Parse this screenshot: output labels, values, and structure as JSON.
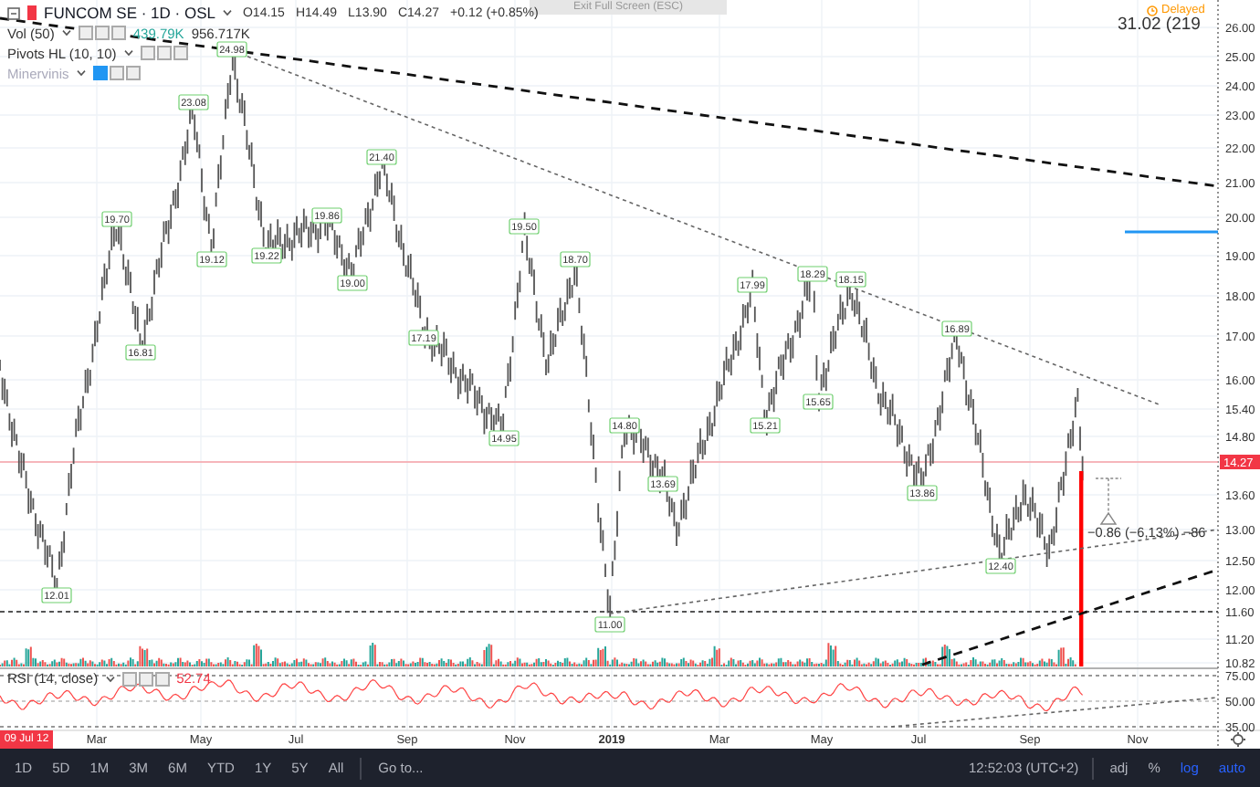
{
  "overlay": {
    "exit_fullscreen": "Exit Full Screen (ESC)",
    "status": "Delayed",
    "corner_text": "31.02 (219"
  },
  "header": {
    "symbol": "FUNCOM SE · 1D · OSL",
    "ohlc": [
      "O14.15",
      "H14.49",
      "L13.90",
      "C14.27"
    ],
    "change": "+0.12 (+0.85%)"
  },
  "indicators": [
    {
      "name": "Vol (50)",
      "disabled": false,
      "values": [
        {
          "text": "439.79K",
          "kind": "up"
        },
        {
          "text": "956.717K",
          "kind": "plain"
        }
      ]
    },
    {
      "name": "Pivots HL (10, 10)",
      "disabled": false
    },
    {
      "name": "Minervinis",
      "disabled": true
    }
  ],
  "pivots": [
    {
      "label": "12.01"
    },
    {
      "label": "19.70"
    },
    {
      "label": "16.81"
    },
    {
      "label": "23.08"
    },
    {
      "label": "19.12"
    },
    {
      "label": "24.98"
    },
    {
      "label": "19.22"
    },
    {
      "label": "19.86"
    },
    {
      "label": "19.00"
    },
    {
      "label": "21.40"
    },
    {
      "label": "17.19"
    },
    {
      "label": "14.95"
    },
    {
      "label": "19.50"
    },
    {
      "label": "18.70"
    },
    {
      "label": "11.00"
    },
    {
      "label": "14.80"
    },
    {
      "label": "13.69"
    },
    {
      "label": "17.99"
    },
    {
      "label": "15.21"
    },
    {
      "label": "18.29"
    },
    {
      "label": "15.65"
    },
    {
      "label": "18.15"
    },
    {
      "label": "13.86"
    },
    {
      "label": "16.89"
    },
    {
      "label": "12.40"
    }
  ],
  "measure": {
    "label": "−0.86 (−6,13%) −86"
  },
  "price_axis": [
    {
      "label": "26.00",
      "kind": "tick"
    },
    {
      "label": "25.00",
      "kind": "tick"
    },
    {
      "label": "24.00",
      "kind": "tick"
    },
    {
      "label": "23.00",
      "kind": "tick"
    },
    {
      "label": "22.00",
      "kind": "tick"
    },
    {
      "label": "21.00",
      "kind": "tick"
    },
    {
      "label": "20.00",
      "kind": "tick"
    },
    {
      "label": "19.00",
      "kind": "tick"
    },
    {
      "label": "18.00",
      "kind": "tick"
    },
    {
      "label": "17.00",
      "kind": "tick"
    },
    {
      "label": "16.00",
      "kind": "tick"
    },
    {
      "label": "15.40",
      "kind": "tick"
    },
    {
      "label": "14.80",
      "kind": "tick"
    },
    {
      "label": "14.27",
      "kind": "current"
    },
    {
      "label": "13.60",
      "kind": "tick"
    },
    {
      "label": "13.00",
      "kind": "tick"
    },
    {
      "label": "12.50",
      "kind": "tick"
    },
    {
      "label": "12.00",
      "kind": "tick"
    },
    {
      "label": "11.60",
      "kind": "tick"
    },
    {
      "label": "11.20",
      "kind": "tick"
    },
    {
      "label": "10.82",
      "kind": "tick"
    }
  ],
  "rsi": {
    "name": "RSI (14, close)",
    "value": "52.74",
    "axis": [
      "75.00",
      "50.00",
      "35.00"
    ]
  },
  "time_axis": {
    "cursor_date": "09 Jul 12",
    "labels": [
      "Mar",
      "May",
      "Jul",
      "Sep",
      "Nov",
      "2019",
      "Mar",
      "May",
      "Jul",
      "Sep",
      "Nov"
    ]
  },
  "toolbar": {
    "ranges": [
      {
        "label": "1D",
        "selected": false
      },
      {
        "label": "5D",
        "selected": false
      },
      {
        "label": "1M",
        "selected": false
      },
      {
        "label": "3M",
        "selected": false
      },
      {
        "label": "6M",
        "selected": false
      },
      {
        "label": "YTD",
        "selected": false
      },
      {
        "label": "1Y",
        "selected": false
      },
      {
        "label": "5Y",
        "selected": false
      },
      {
        "label": "All",
        "selected": false
      }
    ],
    "go_to": "Go to...",
    "clock": "12:52:03 (UTC+2)",
    "toggles": [
      {
        "label": "adj",
        "on": false
      },
      {
        "label": "%",
        "on": false
      },
      {
        "label": "log",
        "on": true
      },
      {
        "label": "auto",
        "on": true
      }
    ]
  }
}
